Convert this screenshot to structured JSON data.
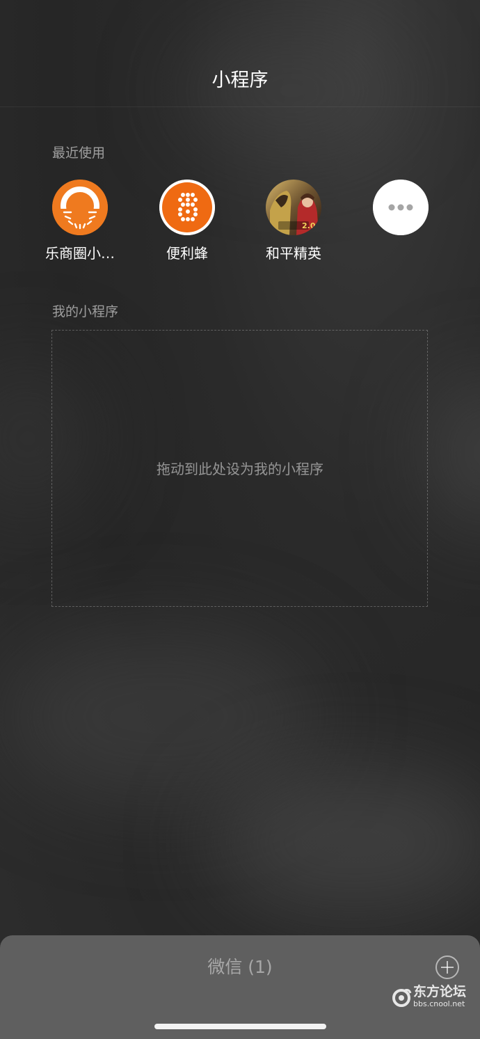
{
  "header": {
    "title": "小程序"
  },
  "recent": {
    "label": "最近使用",
    "items": [
      {
        "name": "乐商圈小…",
        "icon": "lshq-logo-icon",
        "color": "#ef7a1f"
      },
      {
        "name": "便利蜂",
        "icon": "bianlifeng-logo-icon",
        "color": "#ef6a12"
      },
      {
        "name": "和平精英",
        "icon": "heping-jingying-logo-icon",
        "color": "#7b6a44"
      },
      {
        "name": "",
        "icon": "more-icon",
        "color": "#ffffff"
      }
    ]
  },
  "mine": {
    "label": "我的小程序",
    "drop_hint": "拖动到此处设为我的小程序"
  },
  "bottom": {
    "title": "微信 (1)",
    "add_icon": "plus-circle-icon"
  },
  "watermark": {
    "name": "东方论坛",
    "url": "bbs.cnool.net"
  }
}
